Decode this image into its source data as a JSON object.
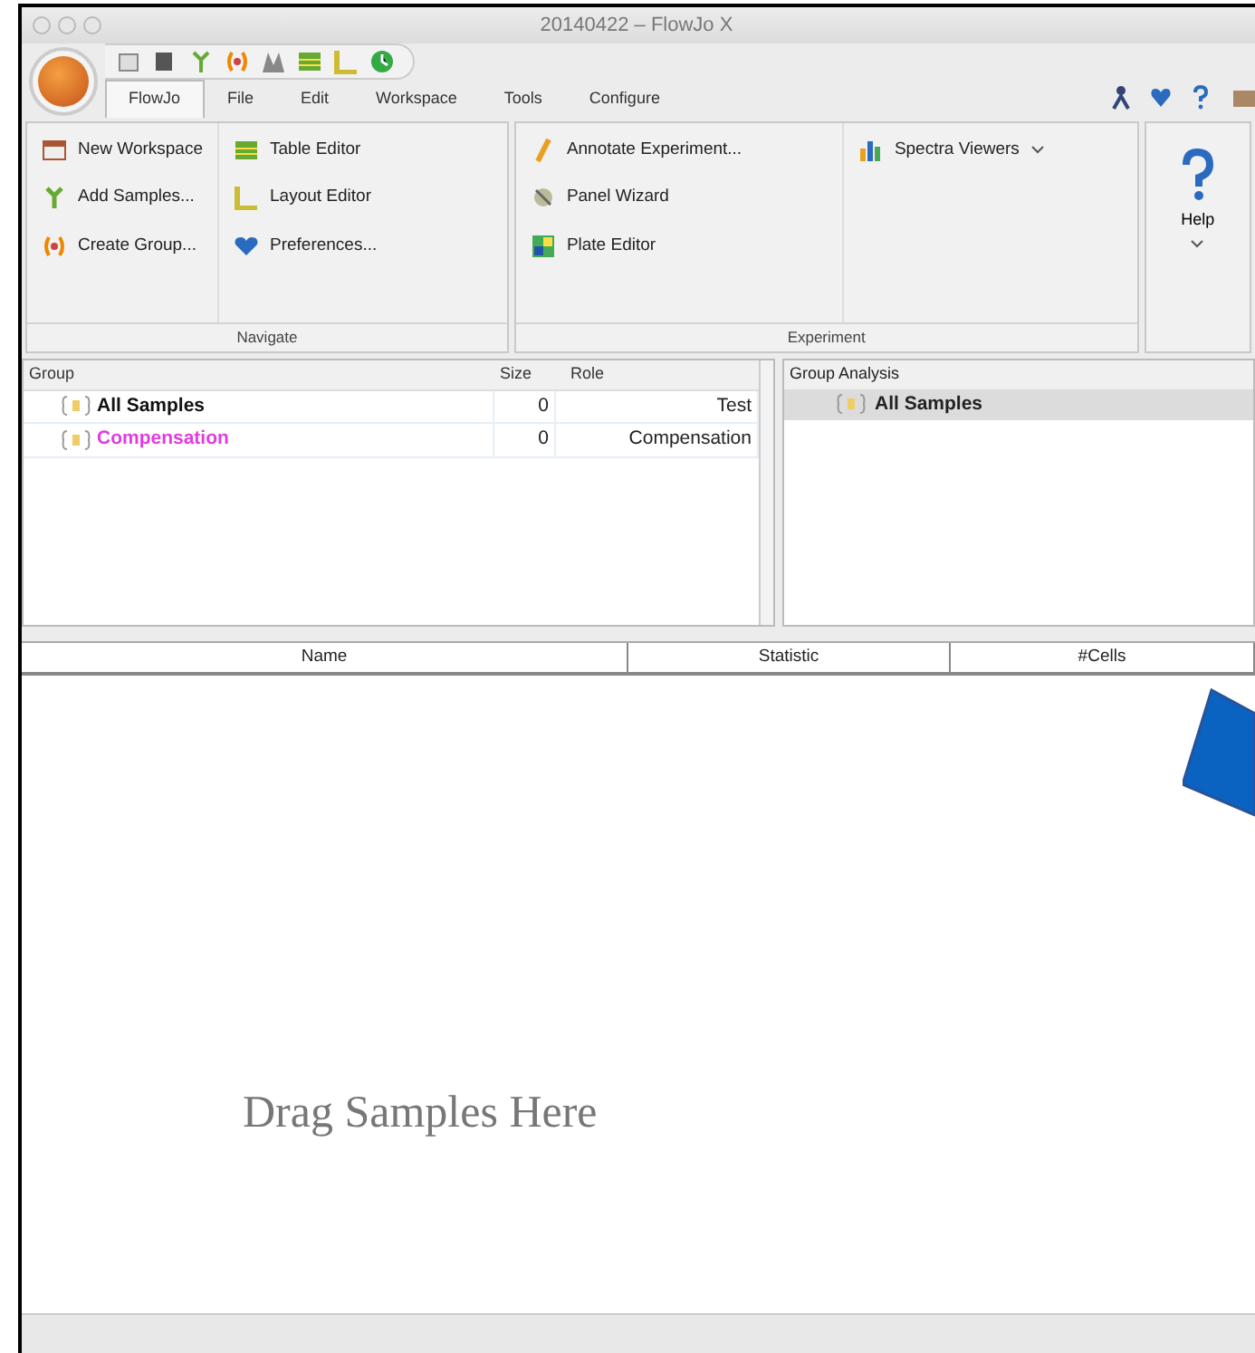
{
  "window": {
    "title": "20140422 – FlowJo X"
  },
  "tabs": [
    {
      "label": "FlowJo",
      "selected": true
    },
    {
      "label": "File",
      "selected": false
    },
    {
      "label": "Edit",
      "selected": false
    },
    {
      "label": "Workspace",
      "selected": false
    },
    {
      "label": "Tools",
      "selected": false
    },
    {
      "label": "Configure",
      "selected": false
    }
  ],
  "ribbon": {
    "sections": [
      {
        "title": "Navigate",
        "columns": [
          [
            {
              "label": "New Workspace",
              "kind": "button"
            },
            {
              "label": "Add Samples...",
              "kind": "button"
            },
            {
              "label": "Create Group...",
              "kind": "button"
            }
          ],
          [
            {
              "label": "Table Editor",
              "kind": "button"
            },
            {
              "label": "Layout Editor",
              "kind": "button"
            },
            {
              "label": "Preferences...",
              "kind": "button"
            }
          ]
        ]
      },
      {
        "title": "Experiment",
        "columns": [
          [
            {
              "label": "Annotate Experiment...",
              "kind": "button"
            },
            {
              "label": "Panel Wizard",
              "kind": "button"
            },
            {
              "label": "Plate Editor",
              "kind": "button"
            }
          ],
          [
            {
              "label": "Spectra Viewers",
              "kind": "dropdown"
            }
          ]
        ]
      }
    ],
    "help": {
      "label": "Help"
    }
  },
  "group_table": {
    "columns": [
      "Group",
      "Size",
      "Role"
    ],
    "rows": [
      {
        "group": "All Samples",
        "size": "0",
        "role": "Test",
        "color": "#111111"
      },
      {
        "group": "Compensation",
        "size": "0",
        "role": "Compensation",
        "color": "#e23ce0"
      }
    ]
  },
  "group_analysis": {
    "title": "Group Analysis",
    "rows": [
      {
        "label": "All Samples",
        "selected": true
      }
    ]
  },
  "stats_table": {
    "columns": [
      "Name",
      "Statistic",
      "#Cells"
    ],
    "empty_message": "Drag Samples Here"
  }
}
